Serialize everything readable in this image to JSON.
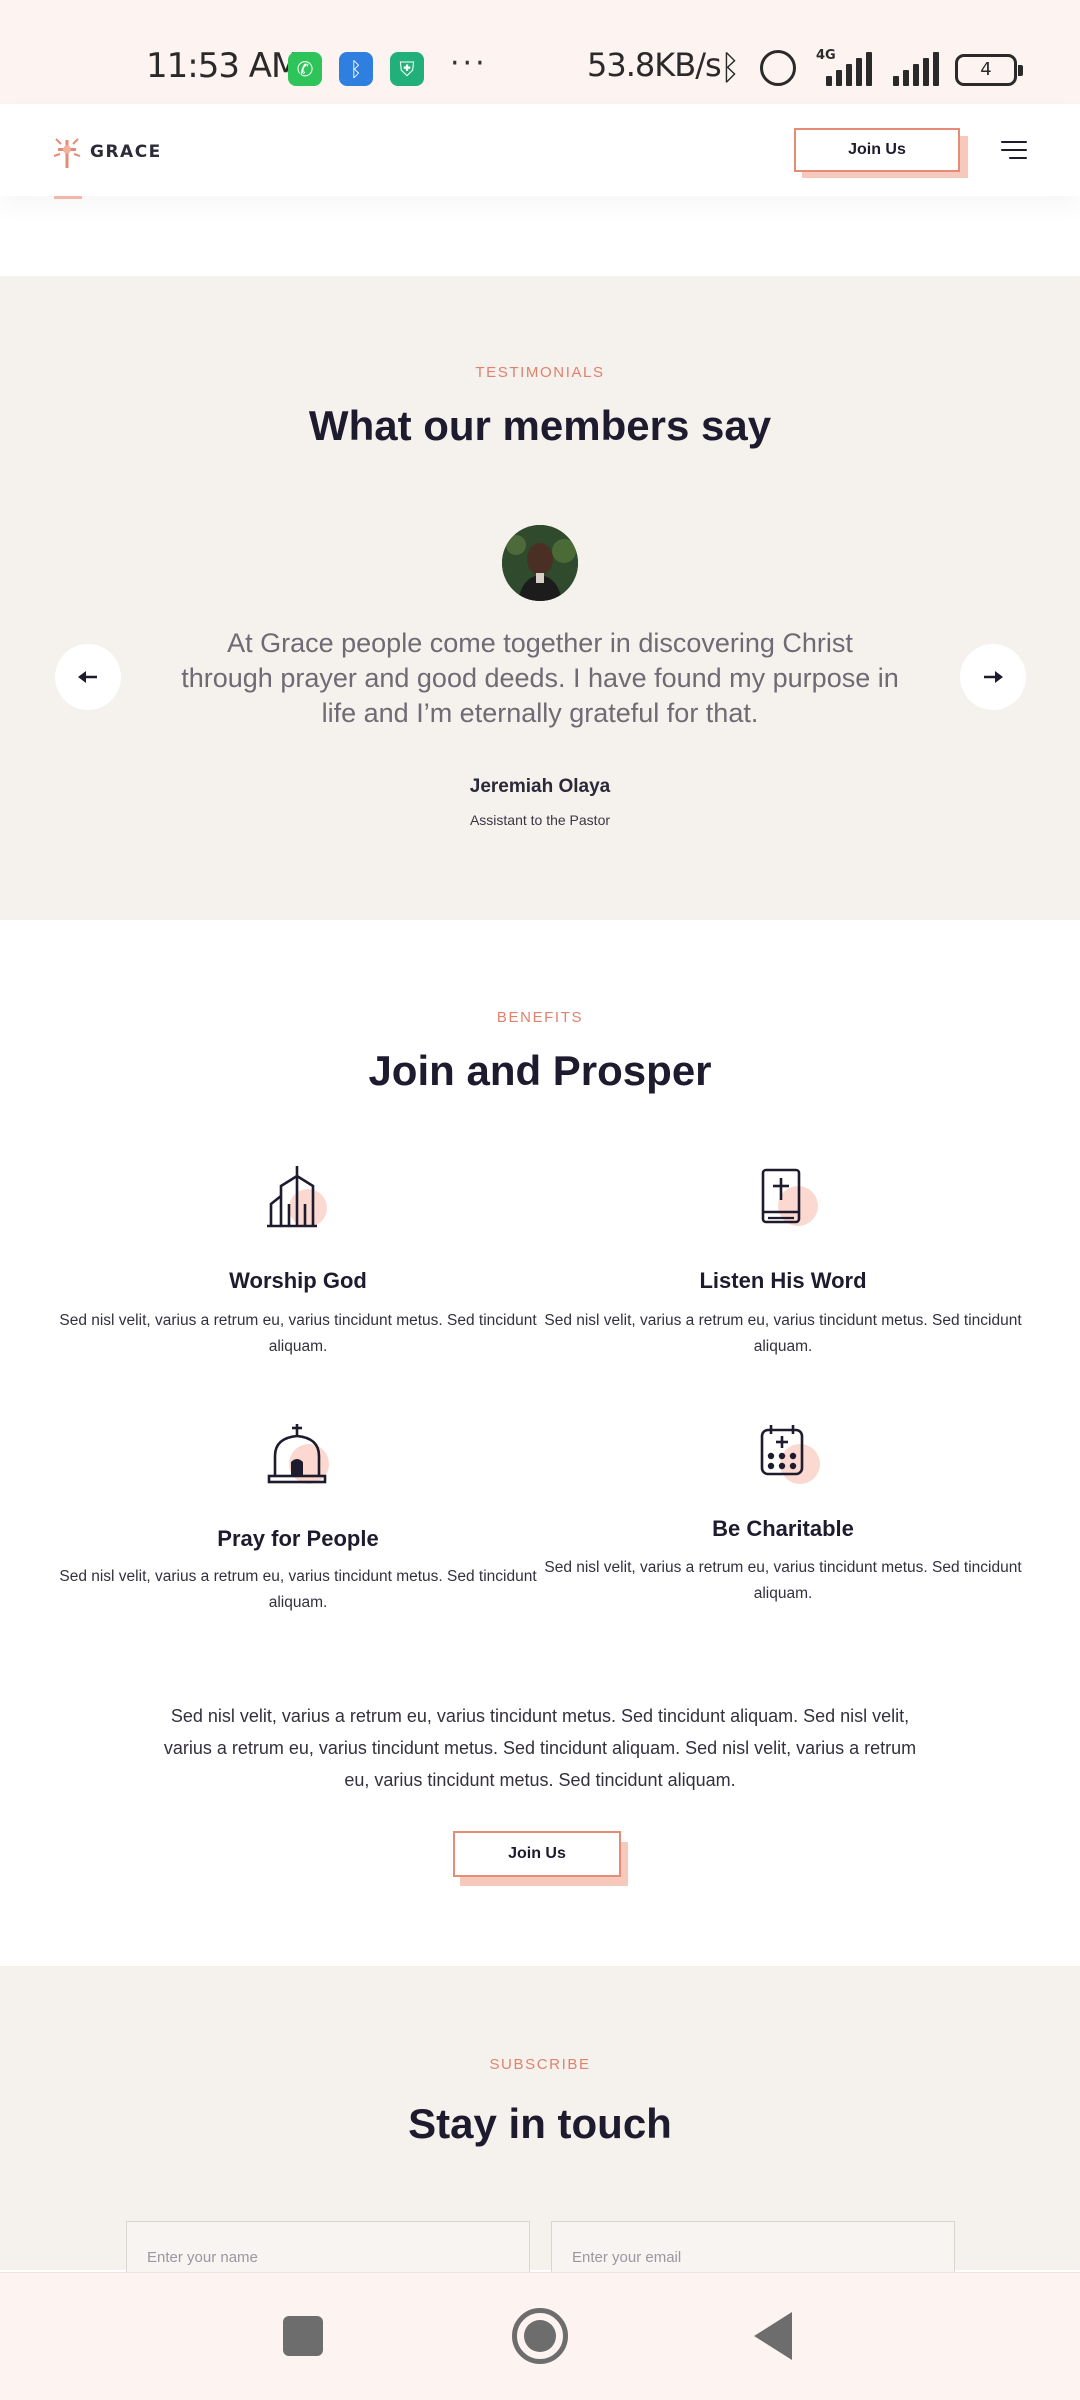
{
  "status_bar": {
    "time": "11:53",
    "ampm": "AM",
    "more": "···",
    "net_speed": "53.8KB/s",
    "network_type": "4G",
    "battery": "4",
    "icons": [
      "whatsapp-icon",
      "bluetooth-app-icon",
      "vpn-shield-icon",
      "bluetooth-icon",
      "alarm-icon",
      "signal-icon",
      "battery-icon"
    ]
  },
  "header": {
    "logo_text": "GRACE",
    "join_label": "Join Us",
    "menu_icon": "hamburger-menu-icon"
  },
  "testimonials": {
    "eyebrow": "TESTIMONIALS",
    "title": "What our members say",
    "quote": "At Grace people come together in discovering Christ through prayer and good deeds. I have found my purpose in life and I’m eternally grateful for that.",
    "author": "Jeremiah Olaya",
    "role": "Assistant to the Pastor",
    "prev_icon": "arrow-left-icon",
    "next_icon": "arrow-right-icon"
  },
  "benefits": {
    "eyebrow": "BENEFITS",
    "title": "Join and Prosper",
    "items": [
      {
        "icon": "church-building-icon",
        "title": "Worship God",
        "desc": "Sed nisl velit, varius a retrum eu, varius tincidunt metus. Sed tincidunt aliquam."
      },
      {
        "icon": "bible-icon",
        "title": "Listen His Word",
        "desc": "Sed nisl velit, varius a retrum eu, varius tincidunt metus. Sed tincidunt aliquam."
      },
      {
        "icon": "chapel-icon",
        "title": "Pray for People",
        "desc": "Sed nisl velit, varius a retrum eu, varius tincidunt metus. Sed tincidunt aliquam."
      },
      {
        "icon": "calendar-icon",
        "title": "Be Charitable",
        "desc": "Sed nisl velit, varius a retrum eu, varius tincidunt metus. Sed tincidunt aliquam."
      }
    ],
    "paragraph": "Sed nisl velit, varius a retrum eu, varius tincidunt metus. Sed tincidunt aliquam. Sed nisl velit, varius a retrum eu, varius tincidunt metus. Sed tincidunt aliquam. Sed nisl velit, varius a retrum eu, varius tincidunt metus. Sed tincidunt aliquam.",
    "join_label": "Join Us"
  },
  "subscribe": {
    "eyebrow": "SUBSCRIBE",
    "title": "Stay in touch",
    "name_placeholder": "Enter your name",
    "email_placeholder": "Enter your email"
  },
  "colors": {
    "accent": "#e58b76",
    "accent_soft": "#f7c9bd",
    "section_bg": "#f5f1ed",
    "heading": "#1f1b2e"
  }
}
